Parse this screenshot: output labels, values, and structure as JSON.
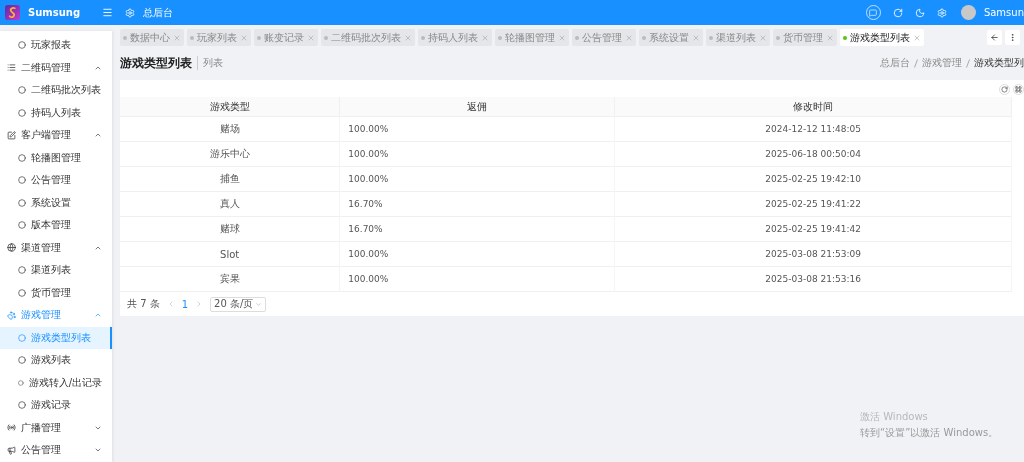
{
  "header": {
    "brand": "Sumsung",
    "title": "总后台",
    "user": "Samsun"
  },
  "tabs": [
    {
      "label": "数据中心",
      "selected": false
    },
    {
      "label": "玩家列表",
      "selected": false
    },
    {
      "label": "账变记录",
      "selected": false
    },
    {
      "label": "二维码批次列表",
      "selected": false
    },
    {
      "label": "持码人列表",
      "selected": false
    },
    {
      "label": "轮播图管理",
      "selected": false
    },
    {
      "label": "公告管理",
      "selected": false
    },
    {
      "label": "系统设置",
      "selected": false
    },
    {
      "label": "渠道列表",
      "selected": false
    },
    {
      "label": "货币管理",
      "selected": false
    },
    {
      "label": "游戏类型列表",
      "selected": true
    }
  ],
  "sidebar": {
    "items": [
      {
        "kind": "link",
        "label": "玩家报表",
        "selected": false
      },
      {
        "kind": "group",
        "label": "二维码管理",
        "expanded": true,
        "children": [
          {
            "label": "二维码批次列表",
            "selected": false
          },
          {
            "label": "持码人列表",
            "selected": false
          }
        ]
      },
      {
        "kind": "group",
        "label": "客户端管理",
        "expanded": true,
        "children": [
          {
            "label": "轮播图管理",
            "selected": false
          },
          {
            "label": "公告管理",
            "selected": false
          },
          {
            "label": "系统设置",
            "selected": false
          },
          {
            "label": "版本管理",
            "selected": false
          }
        ]
      },
      {
        "kind": "group",
        "label": "渠道管理",
        "expanded": true,
        "children": [
          {
            "label": "渠道列表",
            "selected": false
          },
          {
            "label": "货币管理",
            "selected": false
          }
        ]
      },
      {
        "kind": "group",
        "label": "游戏管理",
        "expanded": true,
        "children": [
          {
            "label": "游戏类型列表",
            "selected": true
          },
          {
            "label": "游戏列表",
            "selected": false
          },
          {
            "label": "游戏转入/出记录",
            "selected": false
          },
          {
            "label": "游戏记录",
            "selected": false
          }
        ]
      },
      {
        "kind": "group",
        "label": "广播管理",
        "expanded": false
      },
      {
        "kind": "group",
        "label": "公告管理",
        "expanded": false
      }
    ]
  },
  "page": {
    "title": "游戏类型列表",
    "subtitle": "列表",
    "breadcrumb": [
      "总后台",
      "游戏管理",
      "游戏类型列"
    ]
  },
  "table": {
    "columns": [
      "游戏类型",
      "返佣",
      "修改时间"
    ],
    "rows": [
      {
        "cells": [
          "赌场",
          "100.00%",
          "2024-12-12 11:48:05"
        ]
      },
      {
        "cells": [
          "游乐中心",
          "100.00%",
          "2025-06-18 00:50:04"
        ]
      },
      {
        "cells": [
          "捕鱼",
          "100.00%",
          "2025-02-25 19:42:10"
        ]
      },
      {
        "cells": [
          "真人",
          "16.70%",
          "2025-02-25 19:41:22"
        ]
      },
      {
        "cells": [
          "赌球",
          "16.70%",
          "2025-02-25 19:41:42"
        ]
      },
      {
        "cells": [
          "Slot",
          "100.00%",
          "2025-03-08 21:53:09"
        ]
      },
      {
        "cells": [
          "宾果",
          "100.00%",
          "2025-03-08 21:53:16"
        ]
      }
    ]
  },
  "pagination": {
    "total": "共 7 条",
    "page": "1",
    "page_size": "20 条/页"
  },
  "activation": {
    "title": "激活 Windows",
    "hint": "转到“设置”以激活 Windows。"
  }
}
